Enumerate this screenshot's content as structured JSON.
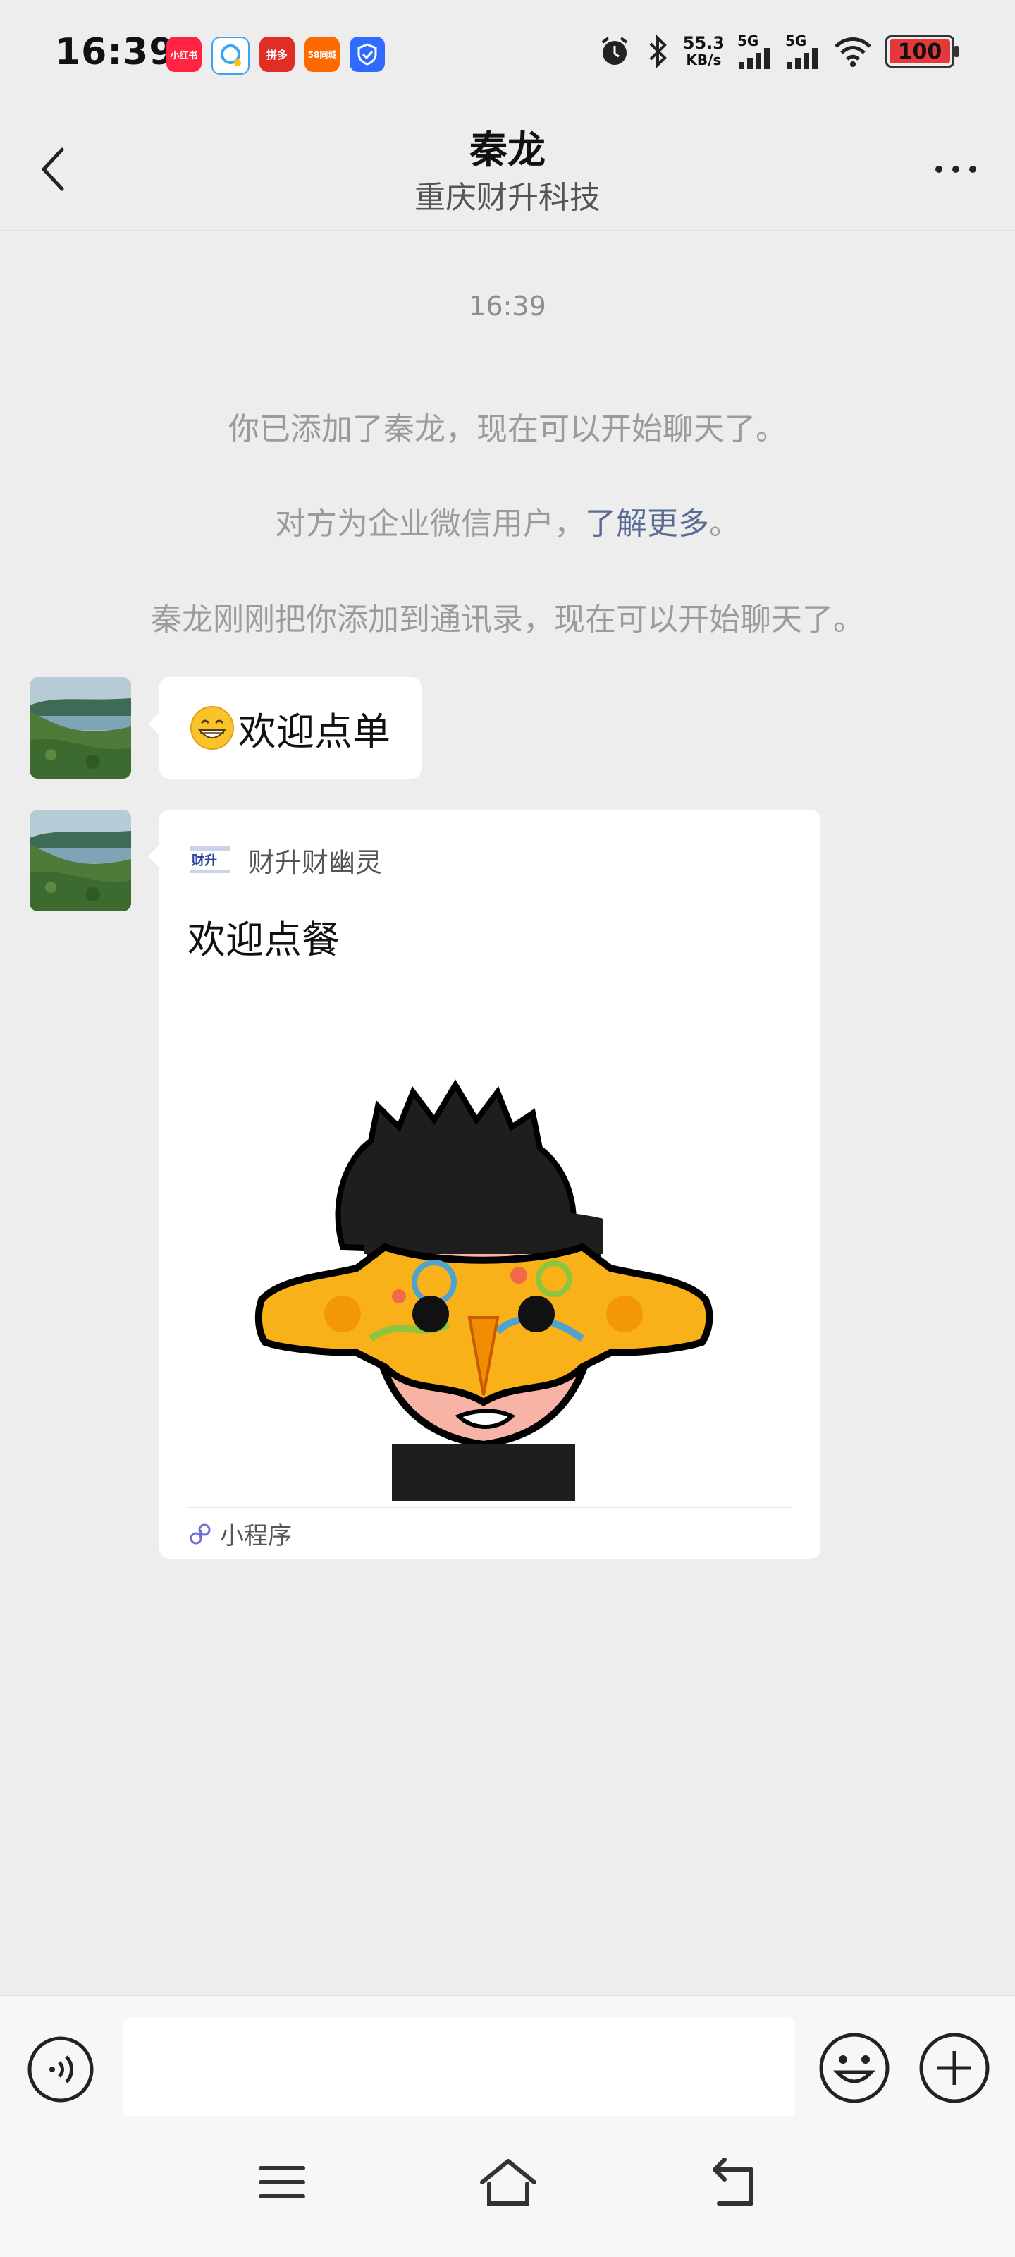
{
  "status_bar": {
    "time": "16:39",
    "apps": [
      "小红书",
      "QQ",
      "拼多",
      "58同城",
      "盾"
    ],
    "net_speed": "55.3",
    "net_unit": "KB/s",
    "sim1": "5G",
    "sim2": "5G",
    "battery": "100",
    "battery_level": 1.0
  },
  "header": {
    "name": "秦龙",
    "org": "重庆财升科技"
  },
  "messages": {
    "timestamp": "16:39",
    "sys1": "你已添加了秦龙，现在可以开始聊天了。",
    "sys2_prefix": "对方为企业微信用户，",
    "sys2_link": "了解更多",
    "sys2_suffix": "。",
    "sys3": "秦龙刚刚把你添加到通讯录，现在可以开始聊天了。",
    "msg1": "欢迎点单",
    "card": {
      "source": "财升财幽灵",
      "title": "欢迎点餐",
      "footer": "小程序"
    }
  },
  "input": {
    "placeholder": ""
  },
  "colors": {
    "background": "#EDEDED",
    "link": "#576B95",
    "system_text": "#9B9B9B"
  }
}
